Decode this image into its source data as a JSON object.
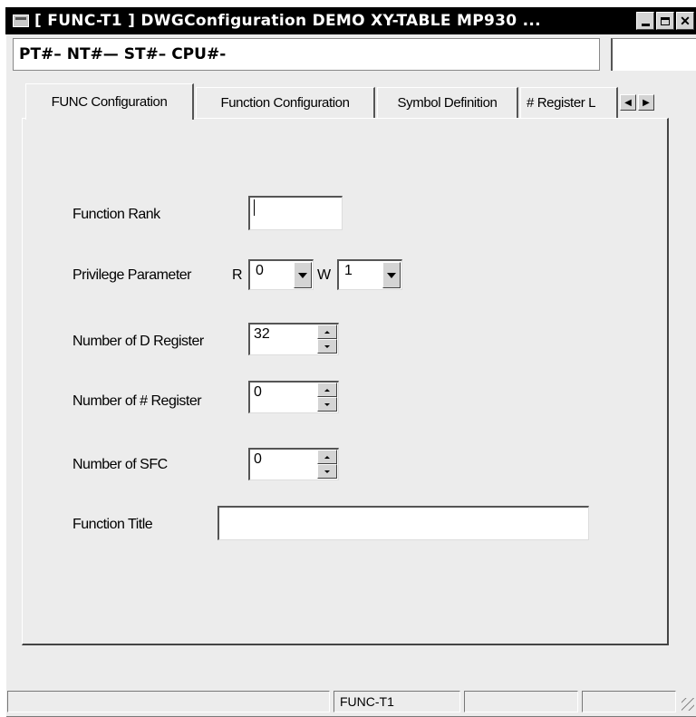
{
  "window": {
    "title": "[ FUNC-T1 ] DWGConfiguration  DEMO  XY-TABLE  MP930    ...",
    "controls": [
      "minimize",
      "maximize",
      "close"
    ]
  },
  "infobar": {
    "text": "PT#– NT#— ST#– CPU#-"
  },
  "tabs": [
    {
      "label": "FUNC Configuration",
      "active": true
    },
    {
      "label": "Function Configuration",
      "active": false
    },
    {
      "label": "Symbol Definition",
      "active": false
    },
    {
      "label": "# Register L",
      "active": false
    }
  ],
  "form": {
    "function_rank": {
      "label": "Function Rank",
      "value": ""
    },
    "privilege": {
      "label": "Privilege Parameter",
      "r_label": "R",
      "r_value": "0",
      "w_label": "W",
      "w_value": "1"
    },
    "d_register": {
      "label": "Number of D Register",
      "value": "32"
    },
    "hash_register": {
      "label": "Number of # Register",
      "value": "0"
    },
    "sfc": {
      "label": "Number of SFC",
      "value": "0"
    },
    "function_title": {
      "label": "Function Title",
      "value": ""
    }
  },
  "statusbar": {
    "panes": [
      "",
      "FUNC-T1",
      "",
      "",
      ""
    ]
  },
  "colors": {
    "face": "#ececec",
    "titlebar": "#000000",
    "field": "#ffffff"
  }
}
